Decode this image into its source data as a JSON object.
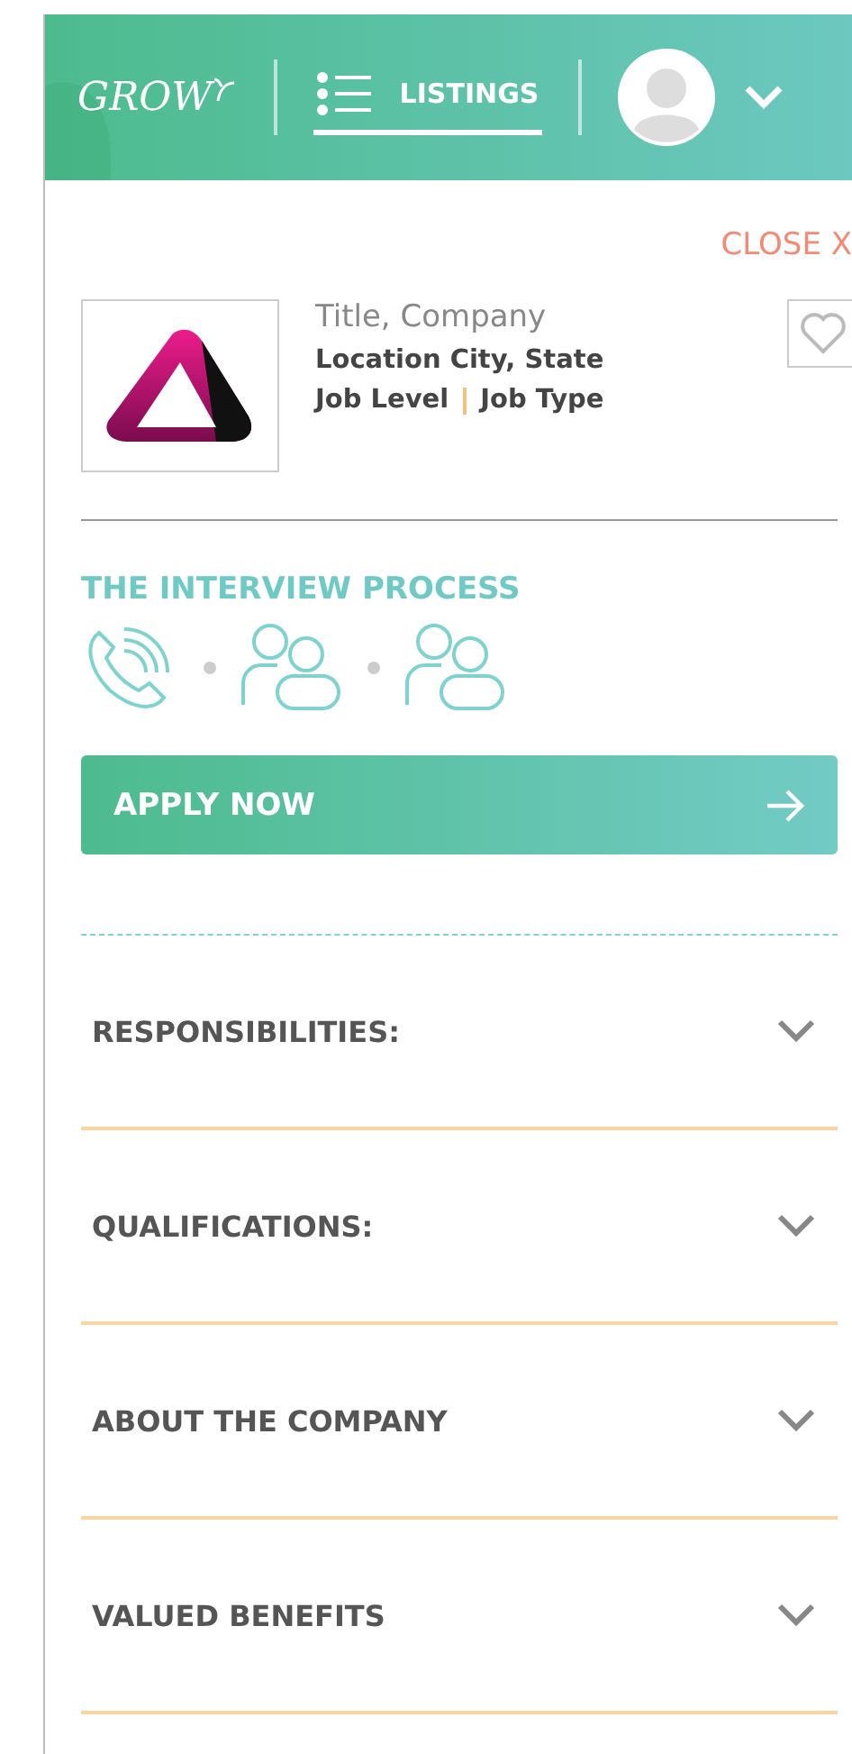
{
  "header": {
    "logo": "GROW",
    "nav": [
      {
        "label": "LISTINGS",
        "selected": true
      }
    ]
  },
  "close": "CLOSE X",
  "job": {
    "title": "Title, Company",
    "location": "Location City, State",
    "level": "Job Level",
    "type": "Job Type",
    "favorite": false
  },
  "interview": {
    "heading": "THE INTERVIEW PROCESS",
    "steps": [
      {
        "kind": "phone"
      },
      {
        "kind": "group"
      },
      {
        "kind": "group"
      }
    ]
  },
  "apply_button": "APPLY NOW",
  "sections": [
    {
      "title": "RESPONSIBILITIES:",
      "expanded": false
    },
    {
      "title": "QUALIFICATIONS:",
      "expanded": false
    },
    {
      "title": "ABOUT THE COMPANY",
      "expanded": false
    },
    {
      "title": "VALUED BENEFITS",
      "expanded": false
    }
  ]
}
